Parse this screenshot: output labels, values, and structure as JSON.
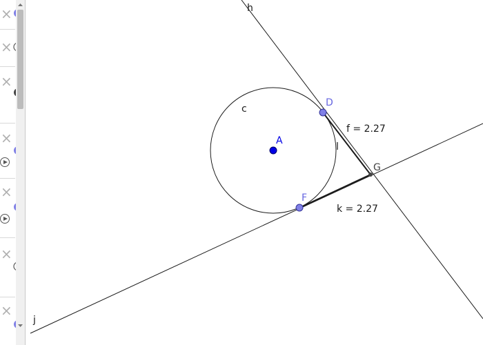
{
  "algebra_view": {
    "delete_glyph": "×",
    "row_count": 6
  },
  "construction": {
    "circle_label": "c",
    "center_label": "A",
    "tangent_point_1": "D",
    "tangent_point_2": "F",
    "intersection_label": "G",
    "line_h_label": "h",
    "line_j_label": "j",
    "segment_i_label": "l",
    "segment_f_text": "f = 2.27",
    "segment_k_text": "k = 2.27"
  },
  "colors": {
    "point_fill": "#8080e6",
    "center_fill": "#0000e6",
    "line": "#1a1a1a",
    "label_blue": "#6666e0"
  }
}
